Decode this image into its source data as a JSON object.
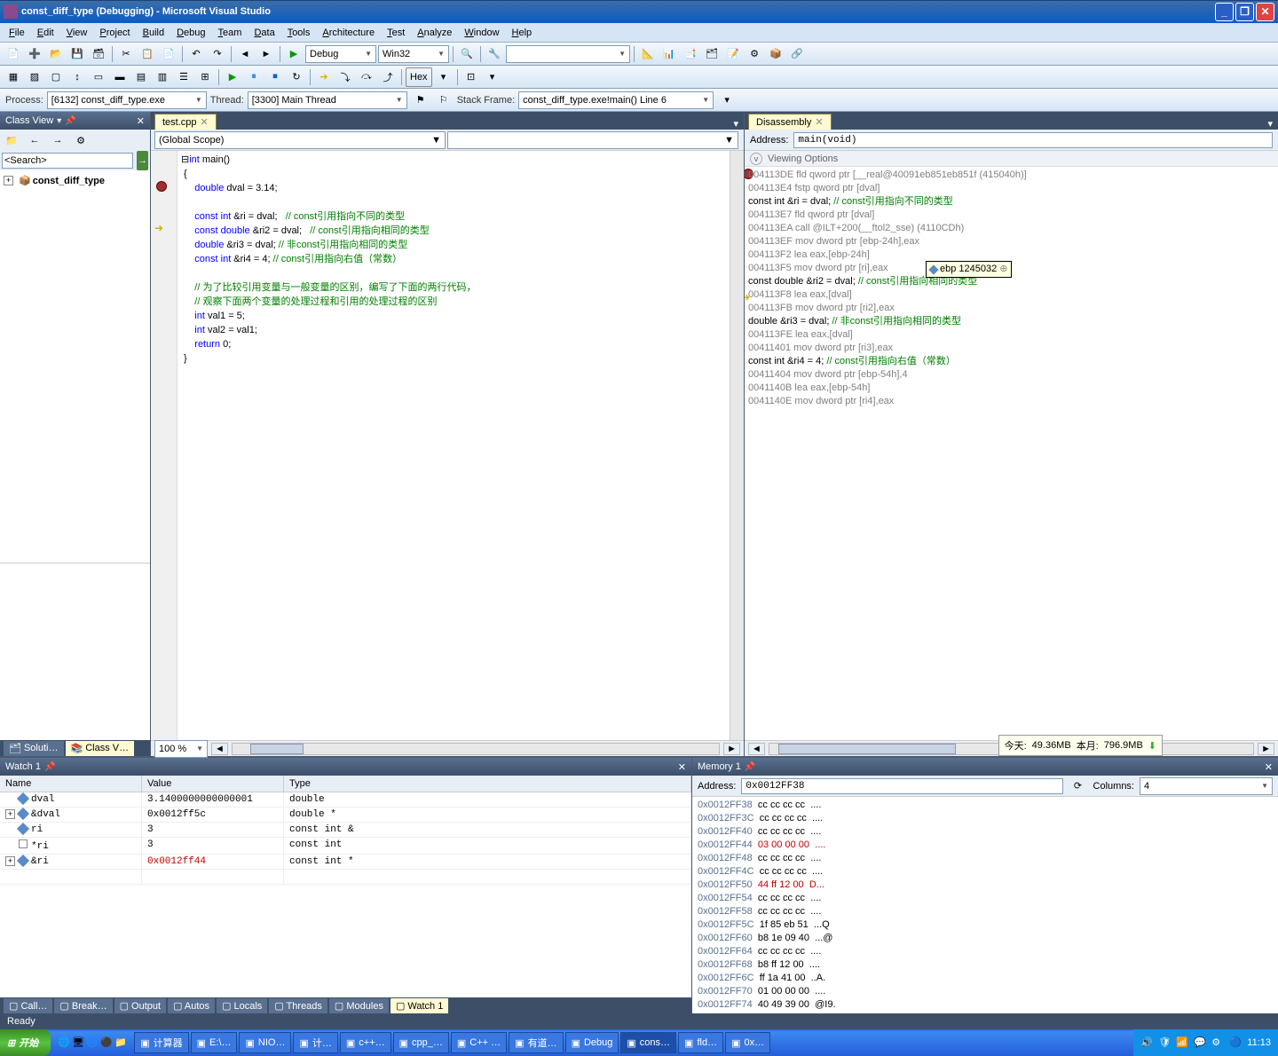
{
  "title": "const_diff_type (Debugging) - Microsoft Visual Studio",
  "menu": [
    "File",
    "Edit",
    "View",
    "Project",
    "Build",
    "Debug",
    "Team",
    "Data",
    "Tools",
    "Architecture",
    "Test",
    "Analyze",
    "Window",
    "Help"
  ],
  "toolbar1": {
    "config": "Debug",
    "platform": "Win32"
  },
  "toolbar2": {
    "hex": "Hex"
  },
  "debugbar": {
    "process_label": "Process:",
    "process": "[6132] const_diff_type.exe",
    "thread_label": "Thread:",
    "thread": "[3300] Main Thread",
    "stackframe_label": "Stack Frame:",
    "stackframe": "const_diff_type.exe!main()  Line 6"
  },
  "classview": {
    "title": "Class View",
    "search": "<Search>",
    "root": "const_diff_type"
  },
  "editor": {
    "tab": "test.cpp",
    "scope": "(Global Scope)",
    "zoom": "100 %",
    "code": [
      {
        "t": "⊟",
        "cls": ""
      },
      {
        "t": "int",
        "cls": "kw"
      },
      {
        "t": " main()",
        "cls": ""
      },
      {
        "nl": 1
      },
      {
        "t": " {",
        "cls": ""
      },
      {
        "nl": 1
      },
      {
        "t": "     ",
        "cls": ""
      },
      {
        "t": "double",
        "cls": "kw"
      },
      {
        "t": " dval = 3.14;",
        "cls": ""
      },
      {
        "nl": 1
      },
      {
        "t": "",
        "cls": ""
      },
      {
        "nl": 1
      },
      {
        "t": "     ",
        "cls": ""
      },
      {
        "t": "const int",
        "cls": "kw"
      },
      {
        "t": " &ri = dval;   ",
        "cls": ""
      },
      {
        "t": "// const引用指向不同的类型",
        "cls": "cm"
      },
      {
        "nl": 1
      },
      {
        "t": "     ",
        "cls": ""
      },
      {
        "t": "const double",
        "cls": "kw"
      },
      {
        "t": " &ri2 = dval;   ",
        "cls": ""
      },
      {
        "t": "// const引用指向相同的类型",
        "cls": "cm"
      },
      {
        "nl": 1
      },
      {
        "t": "     ",
        "cls": ""
      },
      {
        "t": "double",
        "cls": "kw"
      },
      {
        "t": " &ri3 = dval; ",
        "cls": ""
      },
      {
        "t": "// 非const引用指向相同的类型",
        "cls": "cm"
      },
      {
        "nl": 1
      },
      {
        "t": "     ",
        "cls": ""
      },
      {
        "t": "const int",
        "cls": "kw"
      },
      {
        "t": " &ri4 = 4; ",
        "cls": ""
      },
      {
        "t": "// const引用指向右值（常数）",
        "cls": "cm"
      },
      {
        "nl": 1
      },
      {
        "t": "",
        "cls": ""
      },
      {
        "nl": 1
      },
      {
        "t": "     ",
        "cls": ""
      },
      {
        "t": "// 为了比较引用变量与一般变量的区别，编写了下面的两行代码，",
        "cls": "cm"
      },
      {
        "nl": 1
      },
      {
        "t": "     ",
        "cls": ""
      },
      {
        "t": "// 观察下面两个变量的处理过程和引用的处理过程的区别",
        "cls": "cm"
      },
      {
        "nl": 1
      },
      {
        "t": "     ",
        "cls": ""
      },
      {
        "t": "int",
        "cls": "kw"
      },
      {
        "t": " val1 = 5;",
        "cls": ""
      },
      {
        "nl": 1
      },
      {
        "t": "     ",
        "cls": ""
      },
      {
        "t": "int",
        "cls": "kw"
      },
      {
        "t": " val2 = val1;",
        "cls": ""
      },
      {
        "nl": 1
      },
      {
        "t": "     ",
        "cls": ""
      },
      {
        "t": "return",
        "cls": "kw"
      },
      {
        "t": " 0;",
        "cls": ""
      },
      {
        "nl": 1
      },
      {
        "t": " }",
        "cls": ""
      }
    ]
  },
  "disasm": {
    "title": "Disassembly",
    "addr_label": "Address:",
    "addr": "main(void)",
    "viewing": "Viewing Options",
    "tooltip_reg": "ebp",
    "tooltip_val": "1245032",
    "lines": [
      {
        "addr": "004113DE",
        "op": "fld",
        "args": "qword ptr [__real@40091eb851eb851f (415040h)]",
        "gray": 1
      },
      {
        "addr": "004113E4",
        "op": "fstp",
        "args": "qword ptr [dval]",
        "gray": 1
      },
      {
        "src": "     const int &ri = dval;   ",
        "cm": "// const引用指向不同的类型"
      },
      {
        "addr": "004113E7",
        "op": "fld",
        "args": "qword ptr [dval]",
        "gray": 1
      },
      {
        "addr": "004113EA",
        "op": "call",
        "args": "@ILT+200(__ftol2_sse) (4110CDh)",
        "gray": 1
      },
      {
        "addr": "004113EF",
        "op": "mov",
        "args": "dword ptr [ebp-24h],eax",
        "gray": 1
      },
      {
        "addr": "004113F2",
        "op": "lea",
        "args": "eax,[ebp-24h]",
        "gray": 1
      },
      {
        "addr": "004113F5",
        "op": "mov",
        "args": "dword ptr [ri],eax",
        "gray": 1,
        "tooltip": 1
      },
      {
        "src": "     const double &ri2 = dval;   ",
        "cm": "// const引用指向相同的类型"
      },
      {
        "addr": "004113F8",
        "op": "lea",
        "args": "eax,[dval]",
        "gray": 1,
        "cur": 1
      },
      {
        "addr": "004113FB",
        "op": "mov",
        "args": "dword ptr [ri2],eax",
        "gray": 1
      },
      {
        "src": "     double &ri3 = dval; ",
        "cm": "// 非const引用指向相同的类型"
      },
      {
        "addr": "004113FE",
        "op": "lea",
        "args": "eax,[dval]",
        "gray": 1
      },
      {
        "addr": "00411401",
        "op": "mov",
        "args": "dword ptr [ri3],eax",
        "gray": 1
      },
      {
        "src": "     const int &ri4 = 4; ",
        "cm": "// const引用指向右值（常数）"
      },
      {
        "addr": "00411404",
        "op": "mov",
        "args": "dword ptr [ebp-54h],4",
        "gray": 1
      },
      {
        "addr": "0041140B",
        "op": "lea",
        "args": "eax,[ebp-54h]",
        "gray": 1
      },
      {
        "addr": "0041140E",
        "op": "mov",
        "args": "dword ptr [ri4],eax",
        "gray": 1
      }
    ]
  },
  "watch": {
    "title": "Watch 1",
    "cols": [
      "Name",
      "Value",
      "Type"
    ],
    "rows": [
      {
        "exp": "",
        "icon": "d",
        "name": "dval",
        "value": "3.1400000000000001",
        "type": "double"
      },
      {
        "exp": "+",
        "icon": "d",
        "name": "&dval",
        "value": "0x0012ff5c",
        "type": "double *"
      },
      {
        "exp": "",
        "icon": "d",
        "name": "ri",
        "value": "3",
        "type": "const int &"
      },
      {
        "exp": "",
        "icon": "b",
        "name": "*ri",
        "value": "3",
        "type": "const int"
      },
      {
        "exp": "+",
        "icon": "d",
        "name": "&ri",
        "value": "0x0012ff44",
        "type": "const int *",
        "red": 1
      }
    ]
  },
  "memory": {
    "title": "Memory 1",
    "addr_label": "Address:",
    "addr": "0x0012FF38",
    "cols_label": "Columns:",
    "cols": "4",
    "rows": [
      {
        "a": "0x0012FF38",
        "b": "cc cc cc cc",
        "t": "...."
      },
      {
        "a": "0x0012FF3C",
        "b": "cc cc cc cc",
        "t": "...."
      },
      {
        "a": "0x0012FF40",
        "b": "cc cc cc cc",
        "t": "...."
      },
      {
        "a": "0x0012FF44",
        "b": "03 00 00 00",
        "t": "....",
        "red": 1
      },
      {
        "a": "0x0012FF48",
        "b": "cc cc cc cc",
        "t": "...."
      },
      {
        "a": "0x0012FF4C",
        "b": "cc cc cc cc",
        "t": "...."
      },
      {
        "a": "0x0012FF50",
        "b": "44 ff 12 00",
        "t": "D...",
        "red": 1
      },
      {
        "a": "0x0012FF54",
        "b": "cc cc cc cc",
        "t": "...."
      },
      {
        "a": "0x0012FF58",
        "b": "cc cc cc cc",
        "t": "...."
      },
      {
        "a": "0x0012FF5C",
        "b": "1f 85 eb 51",
        "t": "...Q"
      },
      {
        "a": "0x0012FF60",
        "b": "b8 1e 09 40",
        "t": "...@"
      },
      {
        "a": "0x0012FF64",
        "b": "cc cc cc cc",
        "t": "...."
      },
      {
        "a": "0x0012FF68",
        "b": "b8 ff 12 00",
        "t": "...."
      },
      {
        "a": "0x0012FF6C",
        "b": "ff 1a 41 00",
        "t": "..A."
      },
      {
        "a": "0x0012FF70",
        "b": "01 00 00 00",
        "t": "...."
      },
      {
        "a": "0x0012FF74",
        "b": "40 49 39 00",
        "t": "@I9."
      }
    ]
  },
  "bottomtabs_left": [
    "Soluti…",
    "Class V…"
  ],
  "bottomtabs_center": [
    "Call…",
    "Break…",
    "Output",
    "Autos",
    "Locals",
    "Threads",
    "Modules",
    "Watch 1"
  ],
  "status": "Ready",
  "netmon": {
    "today_label": "今天:",
    "today": "49.36MB",
    "month_label": "本月:",
    "month": "796.9MB"
  },
  "start": "开始",
  "tasks": [
    "计算器",
    "E:\\…",
    "NIO…",
    "计…",
    "c++…",
    "cpp_…",
    "C++ …",
    "有道…",
    "Debug",
    "cons…",
    "fld…",
    "0x…"
  ],
  "clock": "11:13"
}
